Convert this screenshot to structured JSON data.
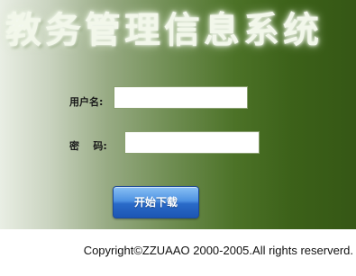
{
  "app": {
    "title": "教务管理信息系统"
  },
  "form": {
    "username_label": "用户名:",
    "username_value": "",
    "password_label": "密    码:",
    "password_value": ""
  },
  "actions": {
    "start_label": "开始下载"
  },
  "footer": {
    "copyright": "Copyright©ZZUAAO 2000-2005.All rights reserverd."
  },
  "colors": {
    "panel_light": "#e9eee4",
    "panel_dark": "#355715",
    "button_blue": "#2a6ac8"
  }
}
